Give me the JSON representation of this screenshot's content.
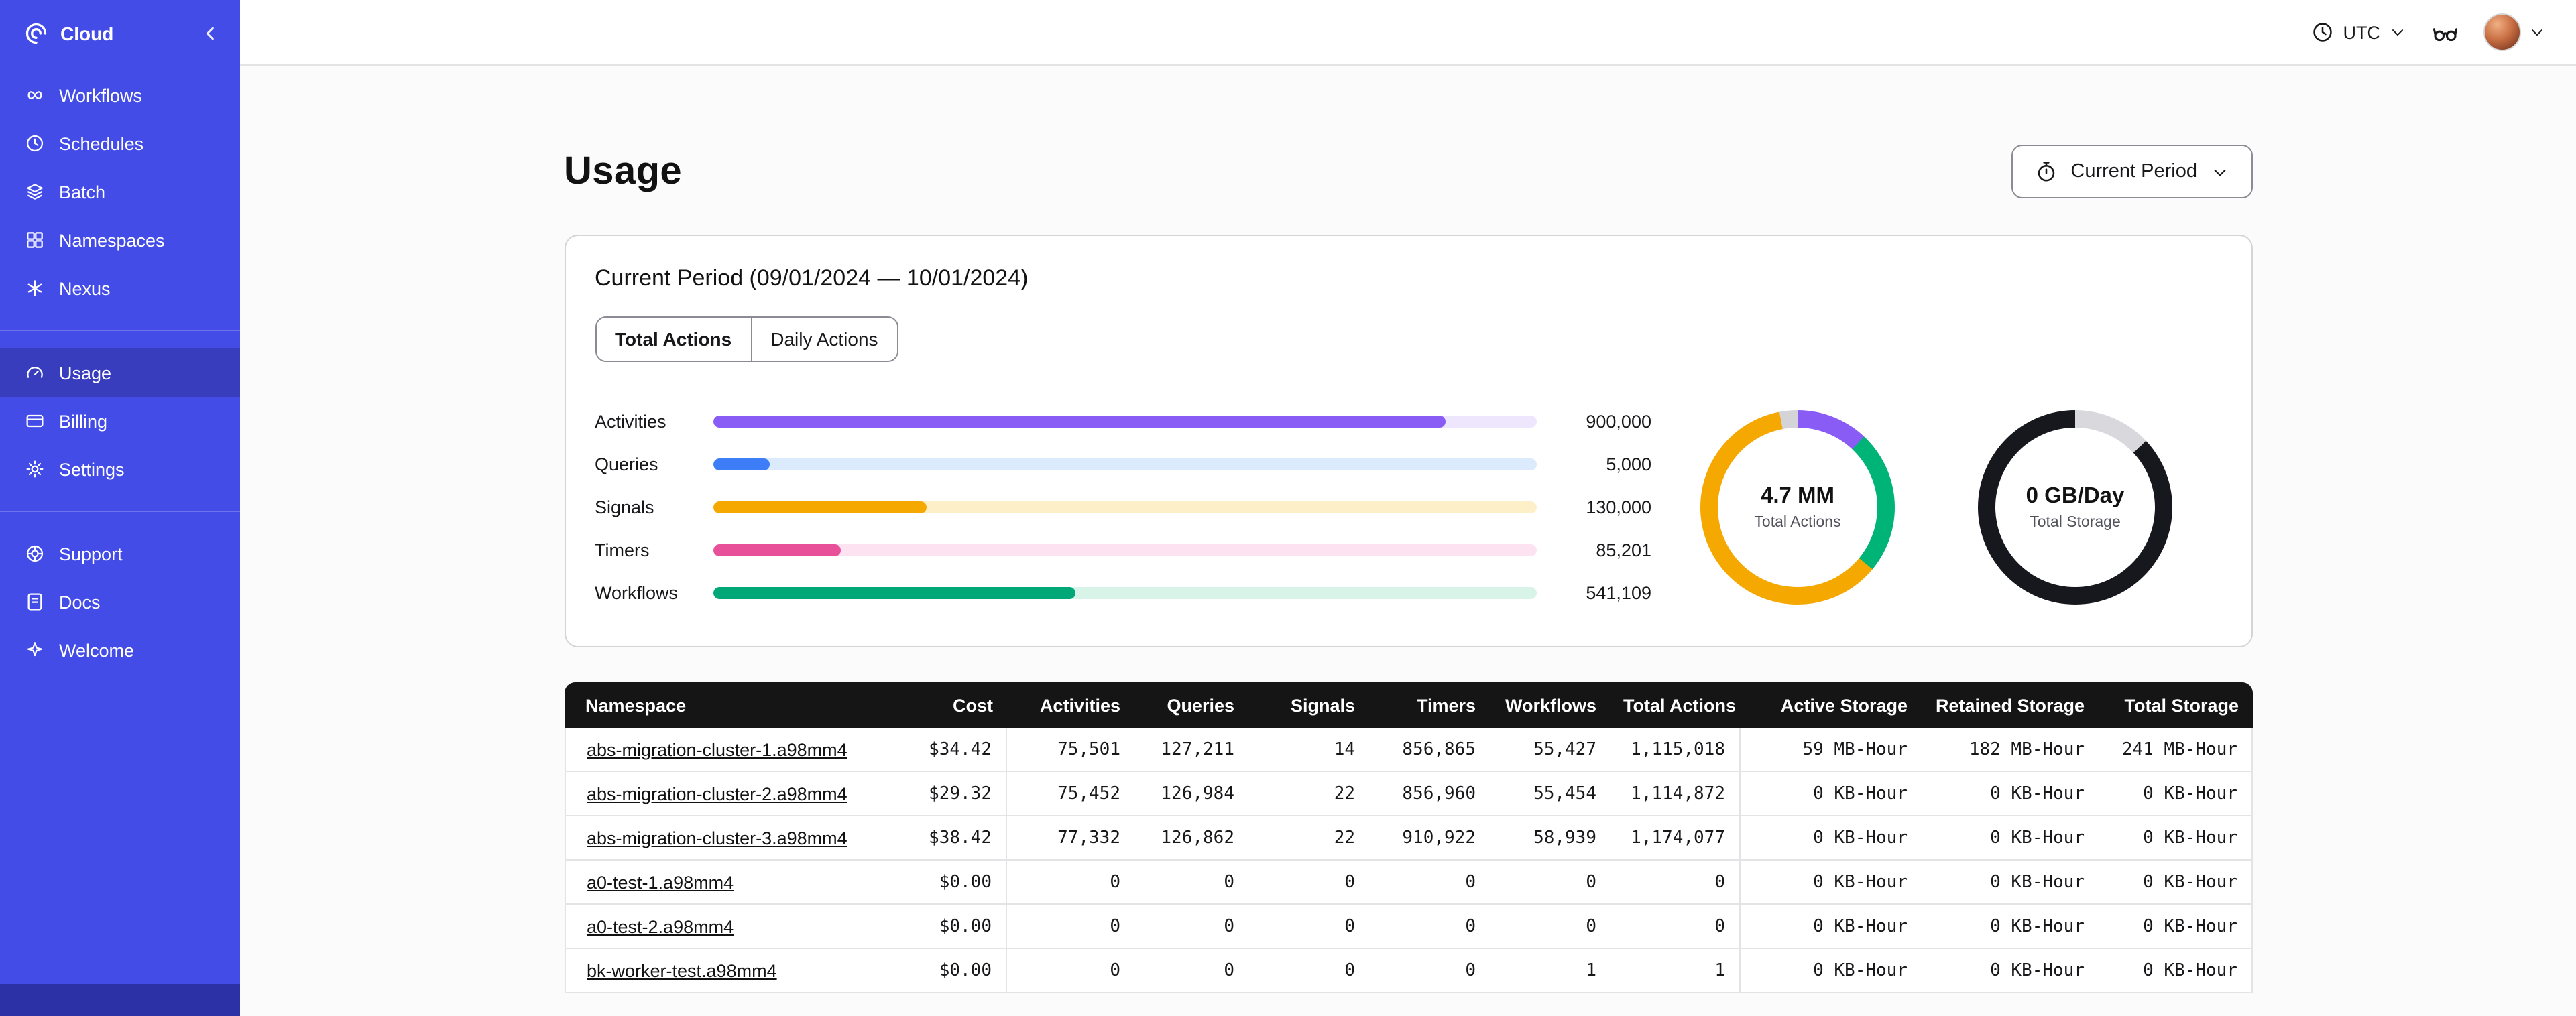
{
  "sidebar": {
    "brand": "Cloud",
    "items_main": [
      {
        "label": "Workflows"
      },
      {
        "label": "Schedules"
      },
      {
        "label": "Batch"
      },
      {
        "label": "Namespaces"
      },
      {
        "label": "Nexus"
      }
    ],
    "items_account": [
      {
        "label": "Usage",
        "active": true
      },
      {
        "label": "Billing"
      },
      {
        "label": "Settings"
      }
    ],
    "items_help": [
      {
        "label": "Support"
      },
      {
        "label": "Docs"
      },
      {
        "label": "Welcome"
      }
    ]
  },
  "topbar": {
    "timezone": "UTC"
  },
  "page": {
    "title": "Usage",
    "period_selector": "Current Period"
  },
  "usage_card": {
    "title": "Current Period (09/01/2024 — 10/01/2024)",
    "tabs": [
      {
        "label": "Total Actions",
        "active": true
      },
      {
        "label": "Daily Actions",
        "active": false
      }
    ],
    "chart_data": {
      "type": "bar",
      "categories": [
        "Activities",
        "Queries",
        "Signals",
        "Timers",
        "Workflows"
      ],
      "values": [
        900000,
        5000,
        130000,
        85201,
        541109
      ],
      "display_values": [
        "900,000",
        "5,000",
        "130,000",
        "85,201",
        "541,109"
      ],
      "bar_percents": [
        89,
        7,
        26,
        15.5,
        44
      ],
      "bar_colors": [
        "#8a5cf6",
        "#3d7df7",
        "#f5a800",
        "#e8509a",
        "#00a878"
      ],
      "track_colors": [
        "#ede6fd",
        "#dceafd",
        "#fdf0c8",
        "#fde3f1",
        "#d8f3e7"
      ]
    },
    "donuts": [
      {
        "value": "4.7 MM",
        "label": "Total Actions",
        "segments": [
          {
            "color": "#8a5cf6",
            "pct": 12
          },
          {
            "color": "#00b377",
            "pct": 24
          },
          {
            "color": "#f5a800",
            "pct": 61
          },
          {
            "color": "#d4d4d8",
            "pct": 3
          }
        ]
      },
      {
        "value": "0 GB/Day",
        "label": "Total Storage",
        "segments": [
          {
            "color": "#d8d8dd",
            "pct": 13
          },
          {
            "color": "#17171e",
            "pct": 87
          }
        ]
      }
    ]
  },
  "usage_table": {
    "headers": [
      "Namespace",
      "Cost",
      "Activities",
      "Queries",
      "Signals",
      "Timers",
      "Workflows",
      "Total Actions",
      "Active Storage",
      "Retained Storage",
      "Total Storage"
    ],
    "rows": [
      [
        "abs-migration-cluster-1.a98mm4",
        "$34.42",
        "75,501",
        "127,211",
        "14",
        "856,865",
        "55,427",
        "1,115,018",
        "59 MB-Hour",
        "182 MB-Hour",
        "241 MB-Hour"
      ],
      [
        "abs-migration-cluster-2.a98mm4",
        "$29.32",
        "75,452",
        "126,984",
        "22",
        "856,960",
        "55,454",
        "1,114,872",
        "0 KB-Hour",
        "0 KB-Hour",
        "0 KB-Hour"
      ],
      [
        "abs-migration-cluster-3.a98mm4",
        "$38.42",
        "77,332",
        "126,862",
        "22",
        "910,922",
        "58,939",
        "1,174,077",
        "0 KB-Hour",
        "0 KB-Hour",
        "0 KB-Hour"
      ],
      [
        "a0-test-1.a98mm4",
        "$0.00",
        "0",
        "0",
        "0",
        "0",
        "0",
        "0",
        "0 KB-Hour",
        "0 KB-Hour",
        "0 KB-Hour"
      ],
      [
        "a0-test-2.a98mm4",
        "$0.00",
        "0",
        "0",
        "0",
        "0",
        "0",
        "0",
        "0 KB-Hour",
        "0 KB-Hour",
        "0 KB-Hour"
      ],
      [
        "bk-worker-test.a98mm4",
        "$0.00",
        "0",
        "0",
        "0",
        "0",
        "1",
        "1",
        "0 KB-Hour",
        "0 KB-Hour",
        "0 KB-Hour"
      ]
    ]
  }
}
